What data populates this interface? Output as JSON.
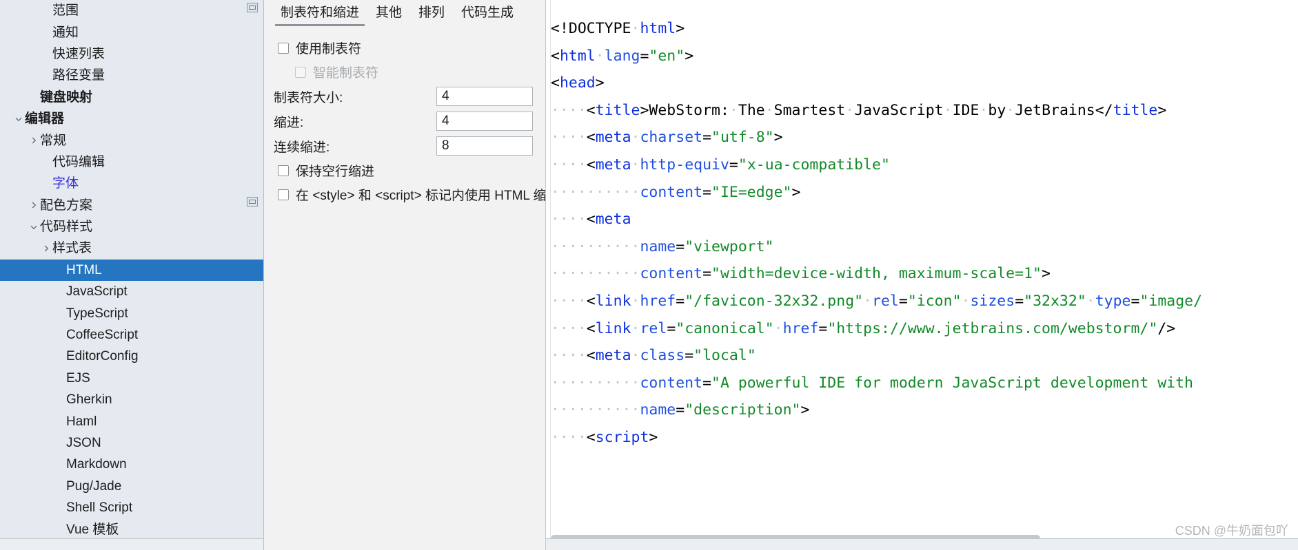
{
  "sidebar": {
    "items": [
      {
        "label": "范围",
        "indent": 2,
        "arrow": "none",
        "state": "normal"
      },
      {
        "label": "通知",
        "indent": 2,
        "arrow": "none",
        "state": "normal"
      },
      {
        "label": "快速列表",
        "indent": 2,
        "arrow": "none",
        "state": "normal"
      },
      {
        "label": "路径变量",
        "indent": 2,
        "arrow": "none",
        "state": "normal"
      },
      {
        "label": "键盘映射",
        "indent": 1,
        "arrow": "none",
        "state": "bold"
      },
      {
        "label": "编辑器",
        "indent": 0,
        "arrow": "expanded",
        "state": "bold"
      },
      {
        "label": "常规",
        "indent": 1,
        "arrow": "collapsed",
        "state": "normal"
      },
      {
        "label": "代码编辑",
        "indent": 2,
        "arrow": "none",
        "state": "normal"
      },
      {
        "label": "字体",
        "indent": 2,
        "arrow": "none",
        "state": "link"
      },
      {
        "label": "配色方案",
        "indent": 1,
        "arrow": "collapsed",
        "state": "normal"
      },
      {
        "label": "代码样式",
        "indent": 1,
        "arrow": "expanded",
        "state": "normal"
      },
      {
        "label": "样式表",
        "indent": 2,
        "arrow": "collapsed",
        "state": "normal"
      },
      {
        "label": "HTML",
        "indent": 3,
        "arrow": "none",
        "state": "selected"
      },
      {
        "label": "JavaScript",
        "indent": 3,
        "arrow": "none",
        "state": "normal"
      },
      {
        "label": "TypeScript",
        "indent": 3,
        "arrow": "none",
        "state": "normal"
      },
      {
        "label": "CoffeeScript",
        "indent": 3,
        "arrow": "none",
        "state": "normal"
      },
      {
        "label": "EditorConfig",
        "indent": 3,
        "arrow": "none",
        "state": "normal"
      },
      {
        "label": "EJS",
        "indent": 3,
        "arrow": "none",
        "state": "normal"
      },
      {
        "label": "Gherkin",
        "indent": 3,
        "arrow": "none",
        "state": "normal"
      },
      {
        "label": "Haml",
        "indent": 3,
        "arrow": "none",
        "state": "normal"
      },
      {
        "label": "JSON",
        "indent": 3,
        "arrow": "none",
        "state": "normal"
      },
      {
        "label": "Markdown",
        "indent": 3,
        "arrow": "none",
        "state": "normal"
      },
      {
        "label": "Pug/Jade",
        "indent": 3,
        "arrow": "none",
        "state": "normal"
      },
      {
        "label": "Shell Script",
        "indent": 3,
        "arrow": "none",
        "state": "normal"
      },
      {
        "label": "Vue 模板",
        "indent": 3,
        "arrow": "none",
        "state": "normal"
      }
    ]
  },
  "settings": {
    "tabs": [
      {
        "label": "制表符和缩进",
        "active": true
      },
      {
        "label": "其他",
        "active": false
      },
      {
        "label": "排列",
        "active": false
      },
      {
        "label": "代码生成",
        "active": false
      }
    ],
    "checkboxes_top": [
      {
        "label": "使用制表符",
        "checked": false,
        "disabled": false,
        "sub": false
      },
      {
        "label": "智能制表符",
        "checked": false,
        "disabled": true,
        "sub": true
      }
    ],
    "fields": [
      {
        "label": "制表符大小:",
        "value": "4"
      },
      {
        "label": "缩进:",
        "value": "4"
      },
      {
        "label": "连续缩进:",
        "value": "8"
      }
    ],
    "checkboxes_bottom": [
      {
        "label": "保持空行缩进",
        "checked": false,
        "disabled": false,
        "sub": false
      },
      {
        "label": "在 <style> 和 <script> 标记内使用 HTML 缩进",
        "checked": false,
        "disabled": false,
        "sub": false
      }
    ]
  },
  "code_preview": {
    "lines": [
      [
        {
          "t": "punct",
          "s": "<!DOCTYPE"
        },
        {
          "t": "ws",
          "s": "·"
        },
        {
          "t": "tag",
          "s": "html"
        },
        {
          "t": "punct",
          "s": ">"
        }
      ],
      [
        {
          "t": "punct",
          "s": "<"
        },
        {
          "t": "tag",
          "s": "html"
        },
        {
          "t": "ws",
          "s": "·"
        },
        {
          "t": "attr",
          "s": "lang"
        },
        {
          "t": "punct",
          "s": "="
        },
        {
          "t": "val",
          "s": "\"en\""
        },
        {
          "t": "punct",
          "s": ">"
        }
      ],
      [
        {
          "t": "punct",
          "s": "<"
        },
        {
          "t": "tag",
          "s": "head"
        },
        {
          "t": "punct",
          "s": ">"
        }
      ],
      [
        {
          "t": "ws",
          "s": "····"
        },
        {
          "t": "punct",
          "s": "<"
        },
        {
          "t": "tag",
          "s": "title"
        },
        {
          "t": "punct",
          "s": ">"
        },
        {
          "t": "text",
          "s": "WebStorm:"
        },
        {
          "t": "ws",
          "s": "·"
        },
        {
          "t": "text",
          "s": "The"
        },
        {
          "t": "ws",
          "s": "·"
        },
        {
          "t": "text",
          "s": "Smartest"
        },
        {
          "t": "ws",
          "s": "·"
        },
        {
          "t": "text",
          "s": "JavaScript"
        },
        {
          "t": "ws",
          "s": "·"
        },
        {
          "t": "text",
          "s": "IDE"
        },
        {
          "t": "ws",
          "s": "·"
        },
        {
          "t": "text",
          "s": "by"
        },
        {
          "t": "ws",
          "s": "·"
        },
        {
          "t": "text",
          "s": "JetBrains"
        },
        {
          "t": "punct",
          "s": "</"
        },
        {
          "t": "tag",
          "s": "title"
        },
        {
          "t": "punct",
          "s": ">"
        }
      ],
      [
        {
          "t": "ws",
          "s": "····"
        },
        {
          "t": "punct",
          "s": "<"
        },
        {
          "t": "tag",
          "s": "meta"
        },
        {
          "t": "ws",
          "s": "·"
        },
        {
          "t": "attr",
          "s": "charset"
        },
        {
          "t": "punct",
          "s": "="
        },
        {
          "t": "val",
          "s": "\"utf-8\""
        },
        {
          "t": "punct",
          "s": ">"
        }
      ],
      [
        {
          "t": "ws",
          "s": "····"
        },
        {
          "t": "punct",
          "s": "<"
        },
        {
          "t": "tag",
          "s": "meta"
        },
        {
          "t": "ws",
          "s": "·"
        },
        {
          "t": "attr",
          "s": "http-equiv"
        },
        {
          "t": "punct",
          "s": "="
        },
        {
          "t": "val",
          "s": "\"x-ua-compatible\""
        }
      ],
      [
        {
          "t": "ws",
          "s": "··········"
        },
        {
          "t": "attr",
          "s": "content"
        },
        {
          "t": "punct",
          "s": "="
        },
        {
          "t": "val",
          "s": "\"IE=edge\""
        },
        {
          "t": "punct",
          "s": ">"
        }
      ],
      [
        {
          "t": "ws",
          "s": "····"
        },
        {
          "t": "punct",
          "s": "<"
        },
        {
          "t": "tag",
          "s": "meta"
        }
      ],
      [
        {
          "t": "ws",
          "s": "··········"
        },
        {
          "t": "attr",
          "s": "name"
        },
        {
          "t": "punct",
          "s": "="
        },
        {
          "t": "val",
          "s": "\"viewport\""
        }
      ],
      [
        {
          "t": "ws",
          "s": "··········"
        },
        {
          "t": "attr",
          "s": "content"
        },
        {
          "t": "punct",
          "s": "="
        },
        {
          "t": "val",
          "s": "\"width=device-width, maximum-scale=1\""
        },
        {
          "t": "punct",
          "s": ">"
        }
      ],
      [
        {
          "t": "ws",
          "s": "····"
        },
        {
          "t": "punct",
          "s": "<"
        },
        {
          "t": "tag",
          "s": "link"
        },
        {
          "t": "ws",
          "s": "·"
        },
        {
          "t": "attr",
          "s": "href"
        },
        {
          "t": "punct",
          "s": "="
        },
        {
          "t": "val",
          "s": "\"/favicon-32x32.png\""
        },
        {
          "t": "ws",
          "s": "·"
        },
        {
          "t": "attr",
          "s": "rel"
        },
        {
          "t": "punct",
          "s": "="
        },
        {
          "t": "val",
          "s": "\"icon\""
        },
        {
          "t": "ws",
          "s": "·"
        },
        {
          "t": "attr",
          "s": "sizes"
        },
        {
          "t": "punct",
          "s": "="
        },
        {
          "t": "val",
          "s": "\"32x32\""
        },
        {
          "t": "ws",
          "s": "·"
        },
        {
          "t": "attr",
          "s": "type"
        },
        {
          "t": "punct",
          "s": "="
        },
        {
          "t": "val",
          "s": "\"image/"
        }
      ],
      [
        {
          "t": "ws",
          "s": "····"
        },
        {
          "t": "punct",
          "s": "<"
        },
        {
          "t": "tag",
          "s": "link"
        },
        {
          "t": "ws",
          "s": "·"
        },
        {
          "t": "attr",
          "s": "rel"
        },
        {
          "t": "punct",
          "s": "="
        },
        {
          "t": "val",
          "s": "\"canonical\""
        },
        {
          "t": "ws",
          "s": "·"
        },
        {
          "t": "attr",
          "s": "href"
        },
        {
          "t": "punct",
          "s": "="
        },
        {
          "t": "val",
          "s": "\"https://www.jetbrains.com/webstorm/\""
        },
        {
          "t": "punct",
          "s": "/>"
        }
      ],
      [
        {
          "t": "ws",
          "s": "····"
        },
        {
          "t": "punct",
          "s": "<"
        },
        {
          "t": "tag",
          "s": "meta"
        },
        {
          "t": "ws",
          "s": "·"
        },
        {
          "t": "attr",
          "s": "class"
        },
        {
          "t": "punct",
          "s": "="
        },
        {
          "t": "val",
          "s": "\"local\""
        }
      ],
      [
        {
          "t": "ws",
          "s": "··········"
        },
        {
          "t": "attr",
          "s": "content"
        },
        {
          "t": "punct",
          "s": "="
        },
        {
          "t": "val",
          "s": "\"A powerful IDE for modern JavaScript development with"
        }
      ],
      [
        {
          "t": "ws",
          "s": "··········"
        },
        {
          "t": "attr",
          "s": "name"
        },
        {
          "t": "punct",
          "s": "="
        },
        {
          "t": "val",
          "s": "\"description\""
        },
        {
          "t": "punct",
          "s": ">"
        }
      ],
      [
        {
          "t": "ws",
          "s": "····"
        },
        {
          "t": "punct",
          "s": "<"
        },
        {
          "t": "tag",
          "s": "script"
        },
        {
          "t": "punct",
          "s": ">"
        }
      ]
    ]
  },
  "watermark": {
    "text": "CSDN @牛奶面包吖"
  },
  "colors": {
    "sidebar_bg": "#e5eaf0",
    "selection": "#2575c0",
    "link": "#3a32d8",
    "settings_bg": "#f2f2f2",
    "tab_underline": "#8c9299",
    "code_tag": "#0d30e0",
    "code_attr": "#1e4fe0",
    "code_value": "#128a28",
    "watermark": "#b6b6b6"
  }
}
